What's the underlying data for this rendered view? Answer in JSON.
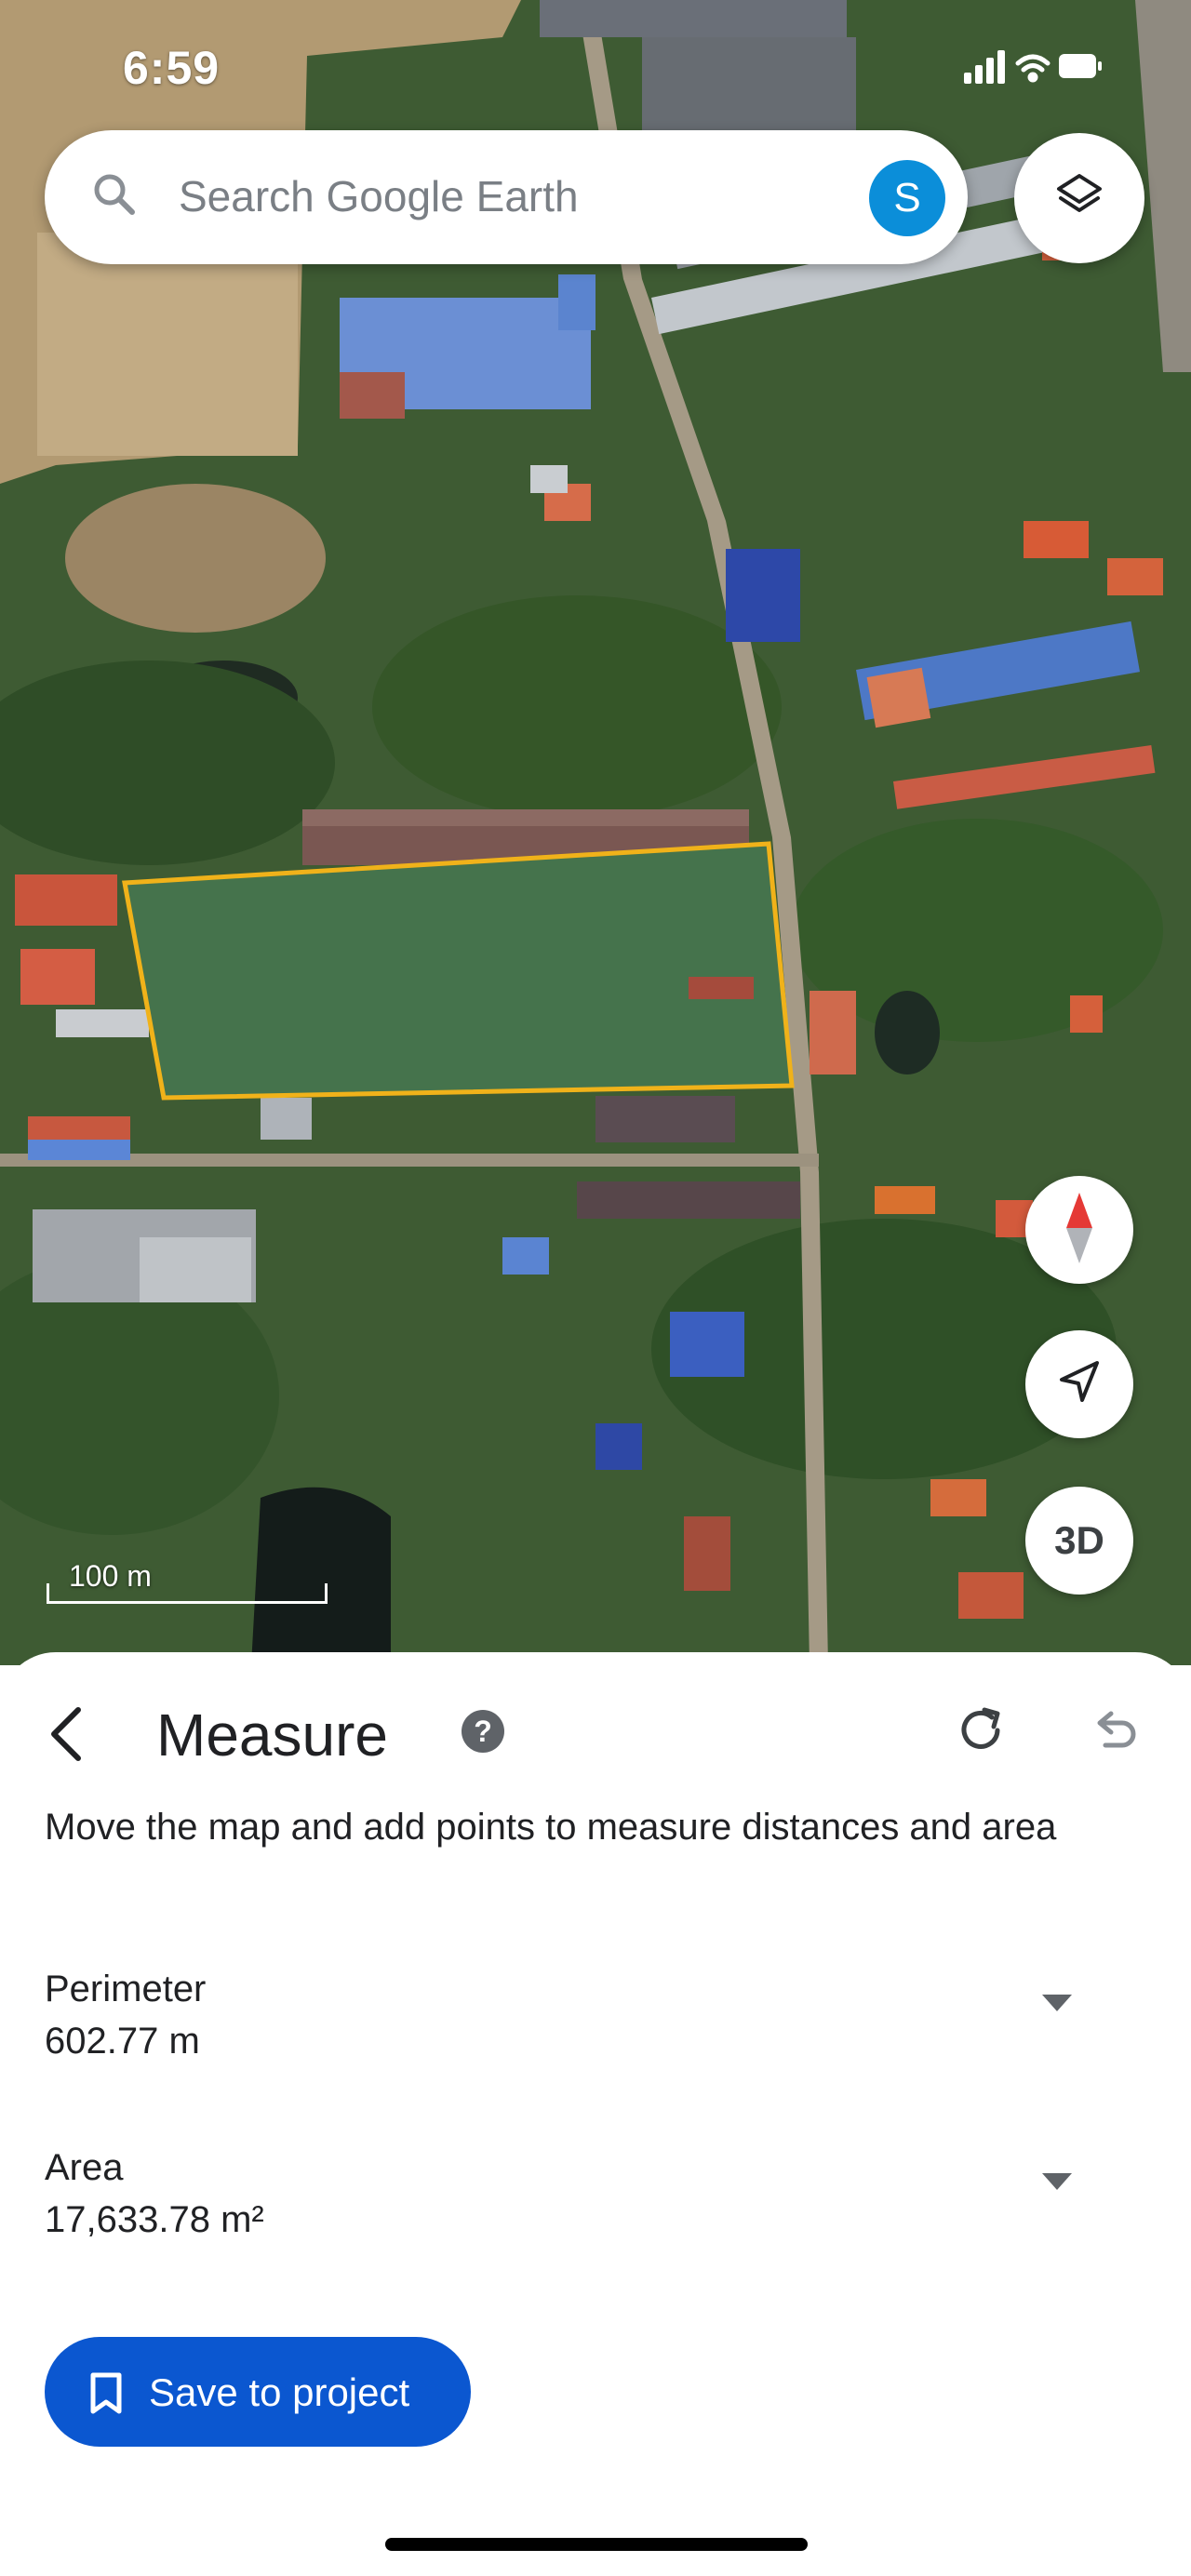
{
  "status_bar": {
    "time": "6:59",
    "icons": [
      "cellular-signal-icon",
      "wifi-icon",
      "battery-icon"
    ]
  },
  "search": {
    "placeholder": "Search Google Earth",
    "avatar_letter": "S",
    "avatar_color": "#0b8ed9"
  },
  "map": {
    "scale_label": "100 m",
    "controls": {
      "compass": "compass-icon",
      "location": "location-arrow-icon",
      "threed_label": "3D"
    },
    "layers_icon": "layers-icon",
    "measure_polygon_color": "#f0b21a"
  },
  "sheet": {
    "title": "Measure",
    "help_glyph": "?",
    "instructions": "Move the map and add points to measure distances and area",
    "metrics": [
      {
        "label": "Perimeter",
        "value": "602.77 m"
      },
      {
        "label": "Area",
        "value": "17,633.78 m²"
      }
    ],
    "save_label": "Save to project",
    "accent_color": "#0b57d0"
  }
}
